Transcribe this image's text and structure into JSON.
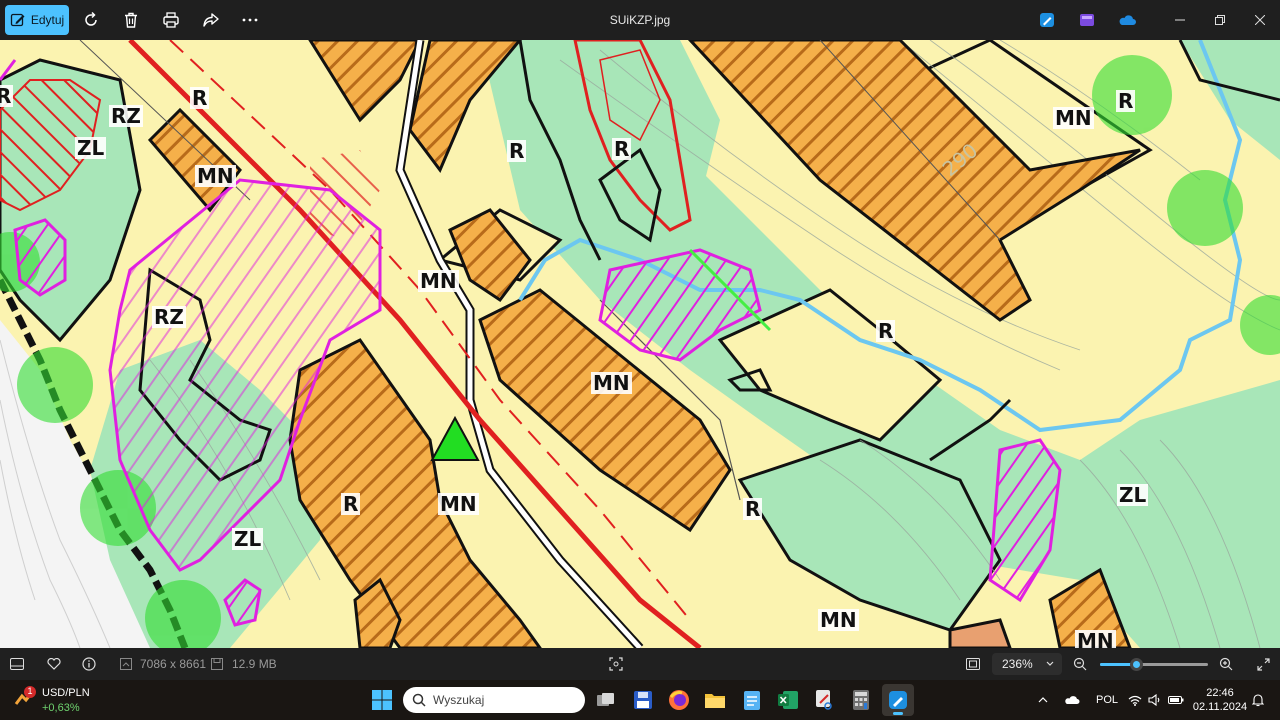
{
  "titlebar": {
    "edit_label": "Edytuj",
    "file_name": "SUiKZP.jpg",
    "icons": [
      "edit-icon",
      "rotate-icon",
      "delete-icon",
      "print-icon",
      "share-icon",
      "more-icon",
      "editor-app-icon",
      "clipchamp-icon",
      "onedrive-icon"
    ],
    "window_controls": [
      "minimize",
      "restore",
      "close"
    ]
  },
  "map": {
    "labels": [
      "R",
      "RZ",
      "ZL",
      "MN",
      "R",
      "R",
      "MN",
      "R",
      "MN",
      "RZ",
      "MN",
      "MN",
      "R",
      "R",
      "MN",
      "R",
      "ZL",
      "ZL",
      "MN",
      "MN",
      "R",
      "290"
    ]
  },
  "infobar": {
    "dimensions": "7086 x 8661",
    "file_size": "12.9 MB",
    "zoom": "236%",
    "zoom_level_fraction": 0.33
  },
  "taskbar": {
    "stock_name": "USD/PLN",
    "stock_change": "+0,63%",
    "stock_badge": "1",
    "search_placeholder": "Wyszukaj",
    "language": "POL",
    "time": "22:46",
    "date": "02.11.2024"
  },
  "colors": {
    "accent": "#4cc2ff",
    "map_yellow": "#fbf3b0",
    "map_green": "#a8e6b8",
    "map_orange": "#f5b04a",
    "map_magenta": "#e020e0",
    "map_red": "#e02020"
  }
}
